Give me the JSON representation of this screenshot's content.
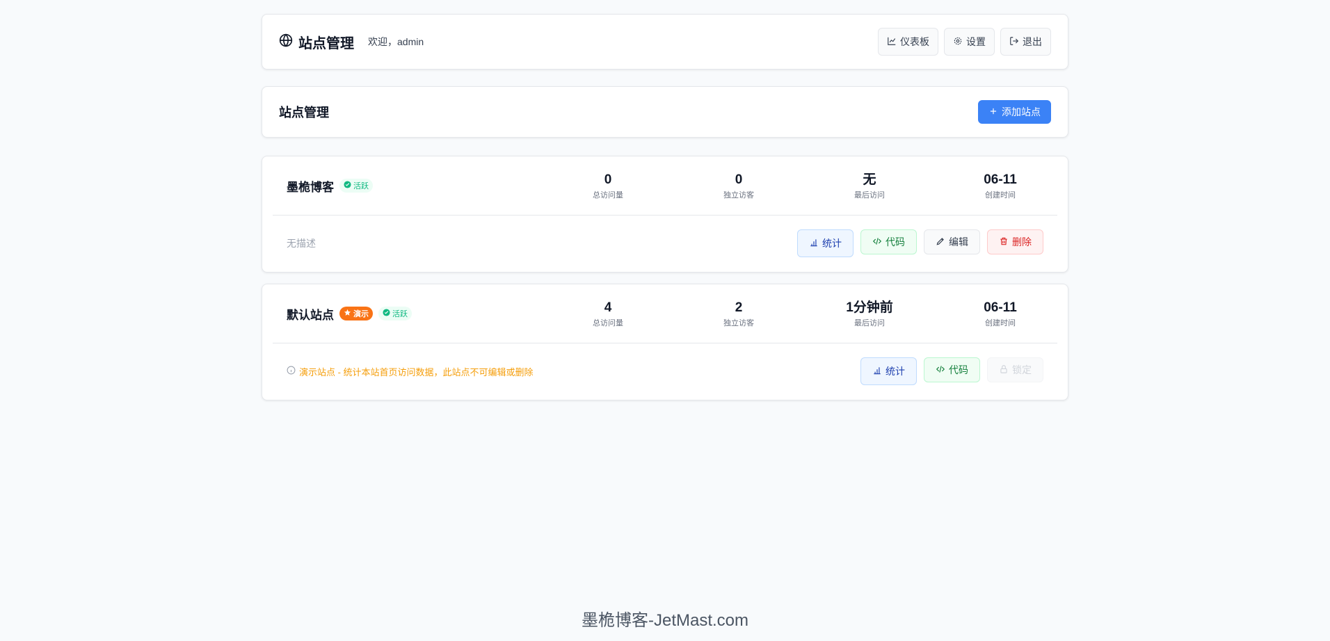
{
  "header": {
    "title": "站点管理",
    "welcome": "欢迎，admin",
    "buttons": {
      "dashboard": "仪表板",
      "settings": "设置",
      "logout": "退出"
    }
  },
  "section": {
    "title": "站点管理",
    "add_button": "添加站点"
  },
  "sites": [
    {
      "name": "墨桅博客",
      "badge_active": "活跃",
      "stats": [
        {
          "value": "0",
          "label": "总访问量"
        },
        {
          "value": "0",
          "label": "独立访客"
        },
        {
          "value": "无",
          "label": "最后访问"
        },
        {
          "value": "06-11",
          "label": "创建时间"
        }
      ],
      "description": "无描述",
      "actions": {
        "stats": "统计",
        "code": "代码",
        "edit": "编辑",
        "delete": "删除"
      }
    },
    {
      "name": "默认站点",
      "badge_demo": "演示",
      "badge_active": "活跃",
      "stats": [
        {
          "value": "4",
          "label": "总访问量"
        },
        {
          "value": "2",
          "label": "独立访客"
        },
        {
          "value": "1分钟前",
          "label": "最后访问"
        },
        {
          "value": "06-11",
          "label": "创建时间"
        }
      ],
      "description": "演示站点 - 统计本站首页访问数据，此站点不可编辑或删除",
      "actions": {
        "stats": "统计",
        "code": "代码",
        "lock": "锁定"
      }
    }
  ],
  "footer": "墨桅博客-JetMast.com"
}
